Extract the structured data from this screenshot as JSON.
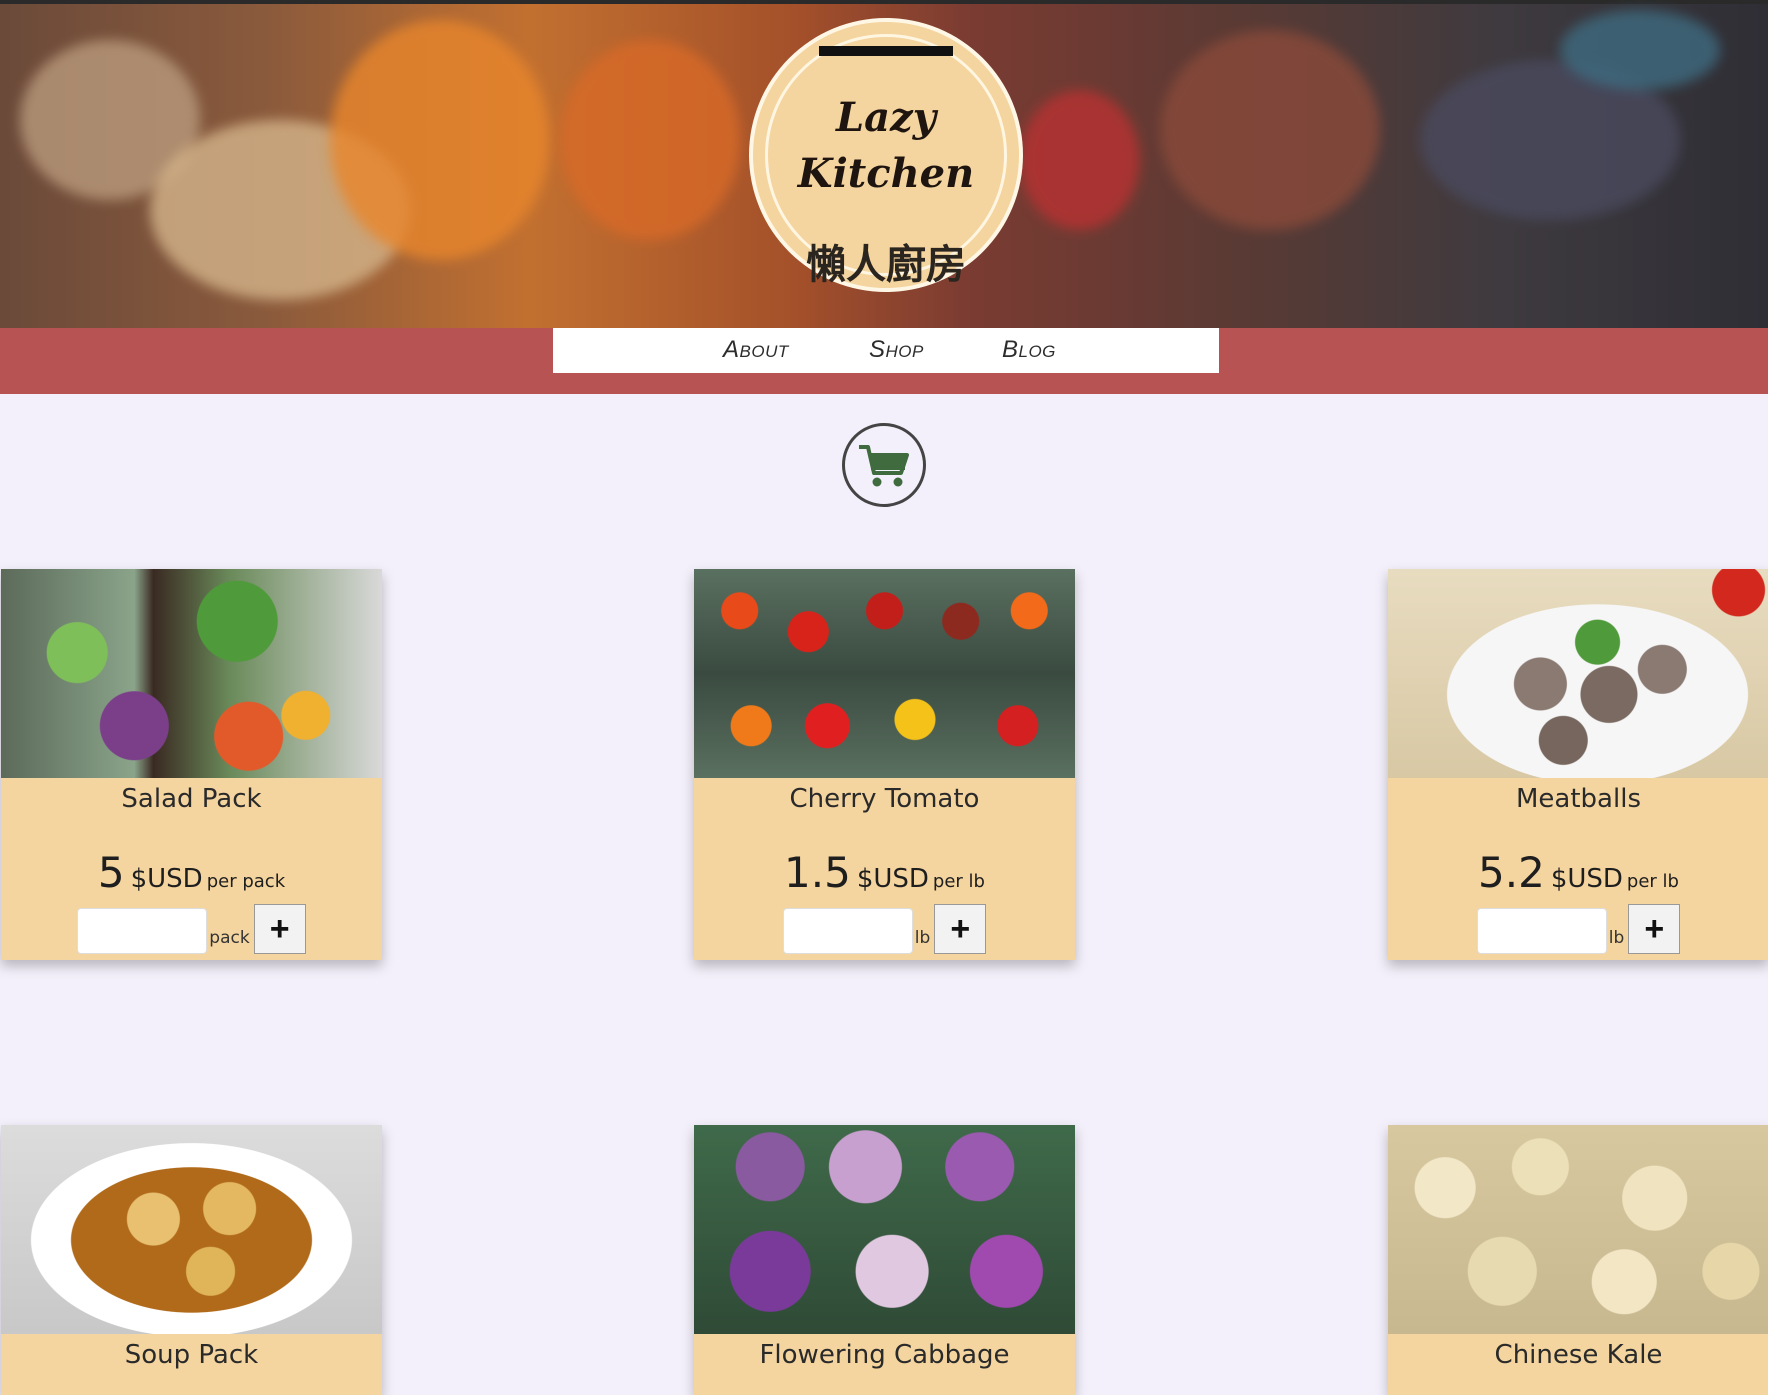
{
  "logo": {
    "english": "Lazy\nKitchen",
    "chinese": "懶人廚房"
  },
  "nav": {
    "items": [
      "About",
      "Shop",
      "Blog"
    ],
    "active": "Shop"
  },
  "cart": {
    "icon": "shopping-cart-icon",
    "color": "#3f6b3f"
  },
  "products": [
    {
      "name": "Salad Pack",
      "price": "5",
      "currency": "$USD",
      "per": "per pack",
      "unit": "pack"
    },
    {
      "name": "Cherry Tomato",
      "price": "1.5",
      "currency": "$USD",
      "per": "per lb",
      "unit": "lb"
    },
    {
      "name": "Meatballs",
      "price": "5.2",
      "currency": "$USD",
      "per": "per lb",
      "unit": "lb"
    },
    {
      "name": "Soup Pack"
    },
    {
      "name": "Flowering Cabbage"
    },
    {
      "name": "Chinese Kale"
    }
  ],
  "colors": {
    "nav_band": "#b85354",
    "card_bg": "#f4d49f",
    "page_bg": "#f4f0fb"
  }
}
